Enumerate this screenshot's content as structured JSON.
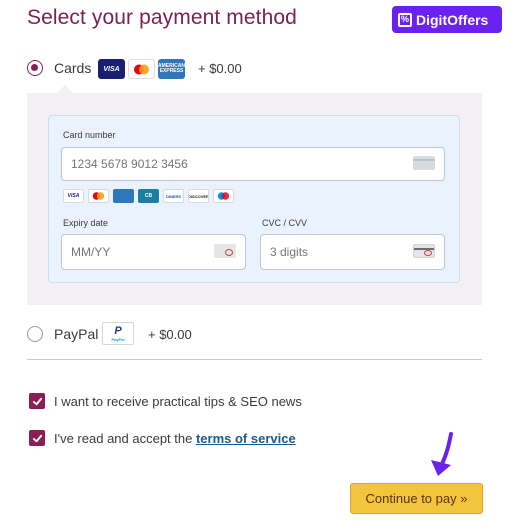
{
  "header": {
    "title": "Select your payment method",
    "brand": "DigitOffers",
    "brand_icon": "percent-icon",
    "brand_color": "#6b21f0"
  },
  "cards_option": {
    "label": "Cards",
    "price": "+ $0.00",
    "selected": true,
    "logos": [
      "VISA",
      "MC",
      "AMERICAN EXPRESS"
    ]
  },
  "card_form": {
    "card_number_label": "Card number",
    "card_number_placeholder": "1234 5678 9012 3456",
    "accepted_logos": [
      "VISA",
      "MC",
      "AMEX",
      "CB",
      "DINERS",
      "DISCOVER",
      "MAESTRO"
    ],
    "expiry_label": "Expiry date",
    "expiry_placeholder": "MM/YY",
    "cvc_label": "CVC / CVV",
    "cvc_placeholder": "3 digits"
  },
  "paypal_option": {
    "label": "PayPal",
    "price": "+ $0.00",
    "selected": false,
    "logo_text": "P",
    "logo_subtext": "PayPal"
  },
  "consents": {
    "tips_label": "I want to receive practical tips & SEO news",
    "tips_checked": true,
    "tos_prefix": "I've read and accept the ",
    "tos_link": "terms of service",
    "tos_checked": true
  },
  "continue_button": {
    "label": "Continue to pay »",
    "color": "#f2c53c"
  },
  "accent_color": "#8a1f55"
}
